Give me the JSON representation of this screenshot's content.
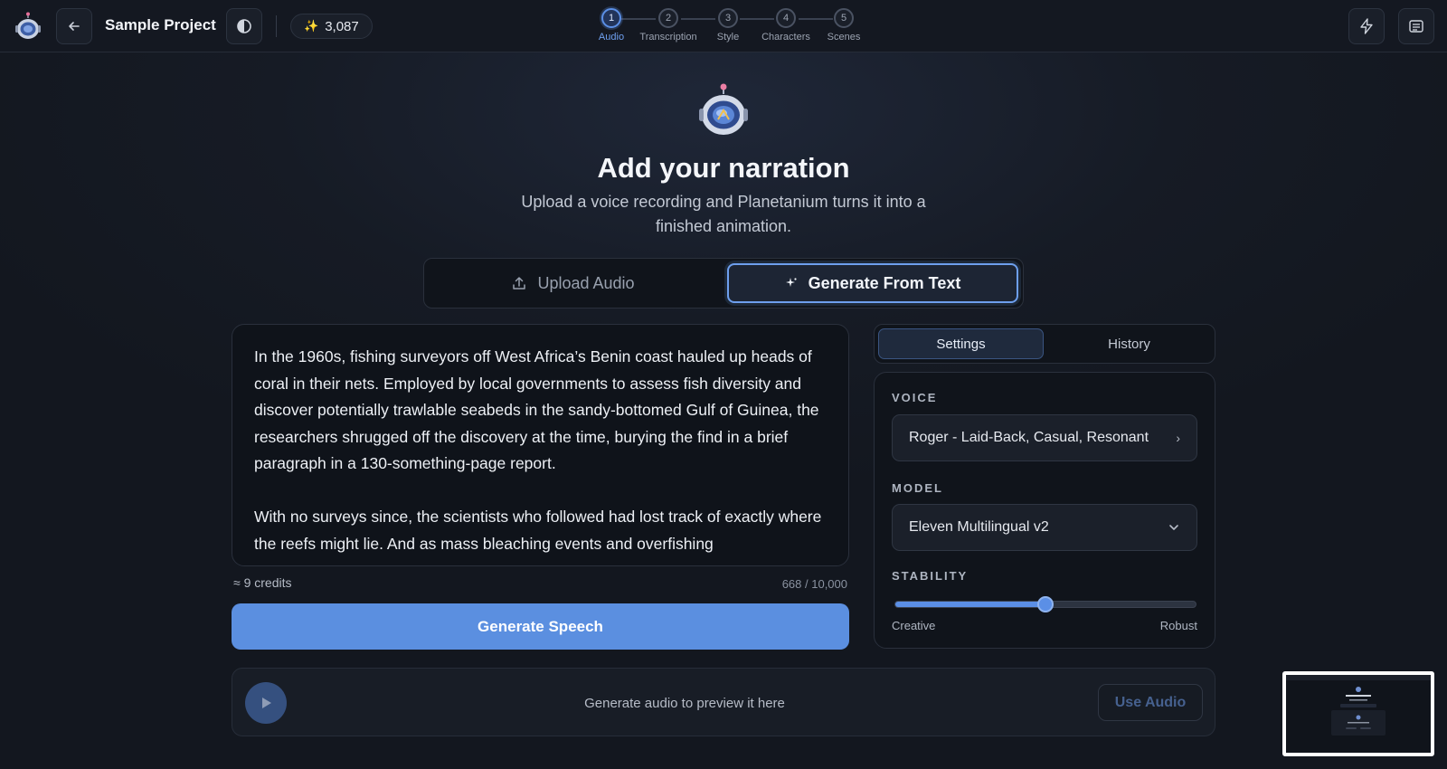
{
  "header": {
    "project_title": "Sample Project",
    "credits": "3,087",
    "icons": [
      "planetanium-logo-icon",
      "arrow-left-icon",
      "contrast-icon",
      "sparkle-icon",
      "lightning-icon",
      "notes-icon"
    ]
  },
  "stepper": {
    "steps": [
      {
        "number": "1",
        "label": "Audio",
        "active": true
      },
      {
        "number": "2",
        "label": "Transcription",
        "active": false
      },
      {
        "number": "3",
        "label": "Style",
        "active": false
      },
      {
        "number": "4",
        "label": "Characters",
        "active": false
      },
      {
        "number": "5",
        "label": "Scenes",
        "active": false
      }
    ]
  },
  "hero": {
    "title": "Add your narration",
    "subtitle": "Upload a voice recording and Planetanium turns it into a finished animation."
  },
  "mode_tabs": {
    "upload_label": "Upload Audio",
    "generate_label": "Generate From Text",
    "selected": "Generate From Text"
  },
  "editor": {
    "text": "In the 1960s, fishing surveyors off West Africa’s Benin coast hauled up heads of coral in their nets. Employed by local governments to assess fish diversity and discover potentially trawlable seabeds in the sandy-bottomed Gulf of Guinea, the researchers shrugged off the discovery at the time, burying the find in a brief paragraph in a 130-something-page report.\n\nWith no surveys since, the scientists who followed had lost track of exactly where the reefs might lie. And as mass bleaching events and overfishing",
    "credits_estimate": "≈ 9 credits",
    "char_count": "668 / 10,000",
    "generate_label": "Generate Speech"
  },
  "panel": {
    "tabs": {
      "settings": "Settings",
      "history": "History"
    },
    "selected_tab": "Settings",
    "voice_label": "VOICE",
    "voice_value": "Roger - Laid-Back, Casual, Resonant",
    "model_label": "MODEL",
    "model_value": "Eleven Multilingual v2",
    "stability_label": "STABILITY",
    "stability_value": 0.5,
    "stability_min_label": "Creative",
    "stability_max_label": "Robust"
  },
  "preview": {
    "placeholder": "Generate audio to preview it here",
    "use_audio_label": "Use Audio"
  },
  "colors": {
    "accent": "#5b8fe0",
    "background": "#161b25",
    "panel": "#10141b"
  }
}
